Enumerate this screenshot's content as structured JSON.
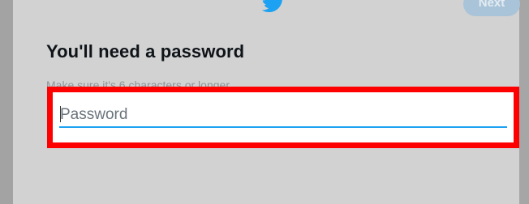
{
  "header": {
    "logo_icon": "twitter-bird-icon",
    "next_label": "Next"
  },
  "dialog": {
    "title": "You'll need a password",
    "subtitle": "Make sure it's 6 characters or longer."
  },
  "password_field": {
    "placeholder": "Password",
    "value": ""
  },
  "colors": {
    "accent": "#1da1f2",
    "highlight": "#ff0000",
    "next_button": "#a9c4d8"
  }
}
